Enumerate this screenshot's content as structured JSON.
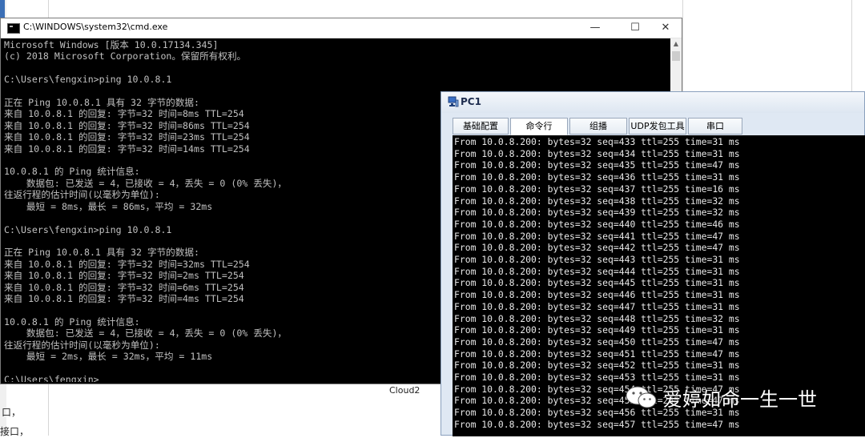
{
  "background": {
    "left_texts": [
      "口，",
      "接口，"
    ],
    "cloud_label": "Cloud2"
  },
  "cmd_window": {
    "title": "C:\\WINDOWS\\system32\\cmd.exe",
    "controls": {
      "minimize": "—",
      "maximize": "☐",
      "close": "✕"
    },
    "lines": [
      "Microsoft Windows [版本 10.0.17134.345]",
      "(c) 2018 Microsoft Corporation。保留所有权利。",
      "",
      "C:\\Users\\fengxin>ping 10.0.8.1",
      "",
      "正在 Ping 10.0.8.1 具有 32 字节的数据:",
      "来自 10.0.8.1 的回复: 字节=32 时间=8ms TTL=254",
      "来自 10.0.8.1 的回复: 字节=32 时间=86ms TTL=254",
      "来自 10.0.8.1 的回复: 字节=32 时间=23ms TTL=254",
      "来自 10.0.8.1 的回复: 字节=32 时间=14ms TTL=254",
      "",
      "10.0.8.1 的 Ping 统计信息:",
      "    数据包: 已发送 = 4，已接收 = 4，丢失 = 0 (0% 丢失)，",
      "往返行程的估计时间(以毫秒为单位):",
      "    最短 = 8ms，最长 = 86ms，平均 = 32ms",
      "",
      "C:\\Users\\fengxin>ping 10.0.8.1",
      "",
      "正在 Ping 10.0.8.1 具有 32 字节的数据:",
      "来自 10.0.8.1 的回复: 字节=32 时间=32ms TTL=254",
      "来自 10.0.8.1 的回复: 字节=32 时间=2ms TTL=254",
      "来自 10.0.8.1 的回复: 字节=32 时间=6ms TTL=254",
      "来自 10.0.8.1 的回复: 字节=32 时间=4ms TTL=254",
      "",
      "10.0.8.1 的 Ping 统计信息:",
      "    数据包: 已发送 = 4，已接收 = 4，丢失 = 0 (0% 丢失)，",
      "往返行程的估计时间(以毫秒为单位):",
      "    最短 = 2ms，最长 = 32ms，平均 = 11ms",
      "",
      "C:\\Users\\fengxin>"
    ]
  },
  "pc1_window": {
    "title": "PC1",
    "tabs": [
      {
        "label": "基础配置",
        "active": false
      },
      {
        "label": "命令行",
        "active": true
      },
      {
        "label": "组播",
        "active": false
      },
      {
        "label": "UDP发包工具",
        "active": false
      },
      {
        "label": "串口",
        "active": false
      }
    ],
    "console_lines": [
      "From 10.0.8.200: bytes=32 seq=433 ttl=255 time=31 ms",
      "From 10.0.8.200: bytes=32 seq=434 ttl=255 time=31 ms",
      "From 10.0.8.200: bytes=32 seq=435 ttl=255 time=47 ms",
      "From 10.0.8.200: bytes=32 seq=436 ttl=255 time=31 ms",
      "From 10.0.8.200: bytes=32 seq=437 ttl=255 time=16 ms",
      "From 10.0.8.200: bytes=32 seq=438 ttl=255 time=32 ms",
      "From 10.0.8.200: bytes=32 seq=439 ttl=255 time=32 ms",
      "From 10.0.8.200: bytes=32 seq=440 ttl=255 time=46 ms",
      "From 10.0.8.200: bytes=32 seq=441 ttl=255 time=47 ms",
      "From 10.0.8.200: bytes=32 seq=442 ttl=255 time=47 ms",
      "From 10.0.8.200: bytes=32 seq=443 ttl=255 time=31 ms",
      "From 10.0.8.200: bytes=32 seq=444 ttl=255 time=31 ms",
      "From 10.0.8.200: bytes=32 seq=445 ttl=255 time=31 ms",
      "From 10.0.8.200: bytes=32 seq=446 ttl=255 time=31 ms",
      "From 10.0.8.200: bytes=32 seq=447 ttl=255 time=31 ms",
      "From 10.0.8.200: bytes=32 seq=448 ttl=255 time=32 ms",
      "From 10.0.8.200: bytes=32 seq=449 ttl=255 time=31 ms",
      "From 10.0.8.200: bytes=32 seq=450 ttl=255 time=47 ms",
      "From 10.0.8.200: bytes=32 seq=451 ttl=255 time=47 ms",
      "From 10.0.8.200: bytes=32 seq=452 ttl=255 time=31 ms",
      "From 10.0.8.200: bytes=32 seq=453 ttl=255 time=31 ms",
      "From 10.0.8.200: bytes=32 seq=454 ttl=255 time=47 ms",
      "From 10.0.8.200: bytes=32 seq=455 ttl=255 time=47 ms",
      "From 10.0.8.200: bytes=32 seq=456 ttl=255 time=31 ms",
      "From 10.0.8.200: bytes=32 seq=457 ttl=255 time=47 ms"
    ]
  },
  "watermark": {
    "text": "爱婷如命一生一世",
    "logo_icon": "wechat-icon"
  },
  "colors": {
    "console_bg": "#000000",
    "cmd_text": "#c0c0c0",
    "pc1_text": "#e8e8e8",
    "pc1_frame": "#dfe8f3"
  }
}
